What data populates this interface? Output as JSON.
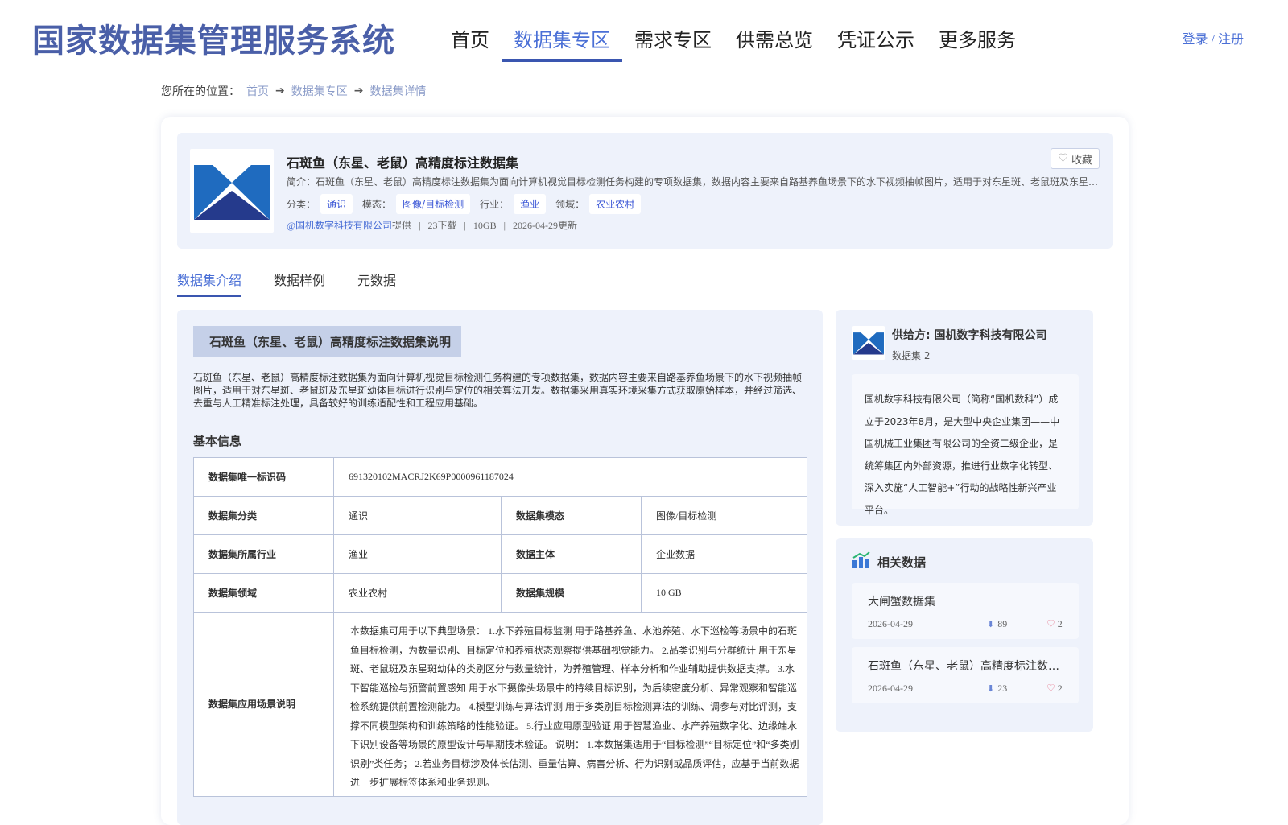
{
  "header": {
    "site_title": "国家数据集管理服务系统",
    "nav": [
      {
        "label": "首页"
      },
      {
        "label": "数据集专区"
      },
      {
        "label": "需求专区"
      },
      {
        "label": "供需总览"
      },
      {
        "label": "凭证公示"
      },
      {
        "label": "更多服务"
      }
    ],
    "active_nav": "数据集专区",
    "auth": "登录 / 注册"
  },
  "breadcrumb": {
    "prefix": "您所在的位置：",
    "items": [
      "首页",
      "数据集专区",
      "数据集详情"
    ]
  },
  "dataset": {
    "title": "石斑鱼（东星、老鼠）高精度标注数据集",
    "favorite_label": "收藏",
    "intro": "简介：石斑鱼（东星、老鼠）高精度标注数据集为面向计算机视觉目标检测任务构建的专项数据集，数据内容主要来自路基养鱼场景下的水下视频抽帧图片，适用于对东星斑、老鼠斑及东星斑幼体目标进行识别与定位的相关算法开发。",
    "tags": [
      {
        "label": "分类：",
        "value": "通识"
      },
      {
        "label": "模态：",
        "value": "图像/目标检测"
      },
      {
        "label": "行业：",
        "value": "渔业"
      },
      {
        "label": "领域：",
        "value": "农业农村"
      }
    ],
    "provider": "@国机数字科技有限公司",
    "provider_suffix": "提供",
    "downloads": "23下载",
    "size": "10GB",
    "updated": "2026-04-29更新",
    "separator": "|"
  },
  "tabs": [
    {
      "label": "数据集介绍"
    },
    {
      "label": "数据样例"
    },
    {
      "label": "元数据"
    }
  ],
  "intro_section": {
    "heading": "石斑鱼（东星、老鼠）高精度标注数据集说明",
    "description": "石斑鱼（东星、老鼠）高精度标注数据集为面向计算机视觉目标检测任务构建的专项数据集，数据内容主要来自路基养鱼场景下的水下视频抽帧图片，适用于对东星斑、老鼠斑及东星斑幼体目标进行识别与定位的相关算法开发。数据集采用真实环境采集方式获取原始样本，并经过筛选、去重与人工精准标注处理，具备较好的训练适配性和工程应用基础。"
  },
  "basic_info": {
    "title": "基本信息",
    "uid_label": "数据集唯一标识码",
    "uid_value": "691320102MACRJ2K69P0000961187024",
    "category_label": "数据集分类",
    "category_value": "通识",
    "modality_label": "数据集模态",
    "modality_value": "图像/目标检测",
    "industry_label": "数据集所属行业",
    "industry_value": "渔业",
    "subject_label": "数据主体",
    "subject_value": "企业数据",
    "domain_label": "数据集领域",
    "domain_value": "农业农村",
    "scale_label": "数据集规模",
    "scale_value": "10 GB",
    "scenario_label": "数据集应用场景说明",
    "scenario_value": "本数据集可用于以下典型场景： 1.水下养殖目标监测 用于路基养鱼、水池养殖、水下巡检等场景中的石斑鱼目标检测，为数量识别、目标定位和养殖状态观察提供基础视觉能力。 2.品类识别与分群统计 用于东星斑、老鼠斑及东星斑幼体的类别区分与数量统计，为养殖管理、样本分析和作业辅助提供数据支撑。 3.水下智能巡检与预警前置感知 用于水下摄像头场景中的持续目标识别，为后续密度分析、异常观察和智能巡检系统提供前置检测能力。 4.模型训练与算法评测 用于多类别目标检测算法的训练、调参与对比评测，支撑不同模型架构和训练策略的性能验证。 5.行业应用原型验证 用于智慧渔业、水产养殖数字化、边缘端水下识别设备等场景的原型设计与早期技术验证。 说明： 1.本数据集适用于“目标检测”“目标定位”和“多类别识别”类任务； 2.若业务目标涉及体长估测、重量估算、病害分析、行为识别或品质评估，应基于当前数据进一步扩展标签体系和业务规则。"
  },
  "supplier": {
    "name": "供给方: 国机数字科技有限公司",
    "count": "数据集 2",
    "description": "国机数字科技有限公司（简称“国机数科”）成立于2023年8月，是大型中央企业集团——中国机械工业集团有限公司的全资二级企业，是统筹集团内外部资源，推进行业数字化转型、深入实施“人工智能+”行动的战略性新兴产业平台。"
  },
  "related": {
    "title": "相关数据",
    "items": [
      {
        "name": "大闸蟹数据集",
        "date": "2026-04-29",
        "downloads": "89",
        "favorites": "2"
      },
      {
        "name": "石斑鱼（东星、老鼠）高精度标注数据集",
        "date": "2026-04-29",
        "downloads": "23",
        "favorites": "2"
      }
    ]
  },
  "colors": {
    "brand": "#4a5fa8",
    "accent": "#4a6fd6",
    "panel_bg": "#eef2fb"
  }
}
